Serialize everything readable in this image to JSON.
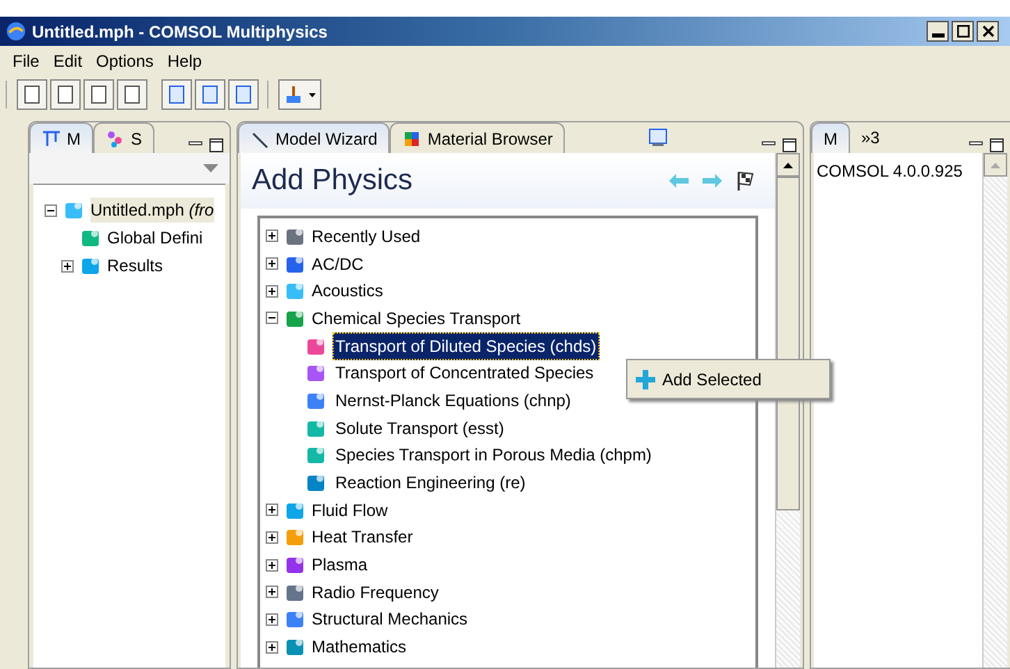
{
  "window": {
    "title": "Untitled.mph - COMSOL Multiphysics"
  },
  "menu": [
    "File",
    "Edit",
    "Options",
    "Help"
  ],
  "left_panel": {
    "tabs": [
      {
        "label": "M",
        "selected": true
      },
      {
        "label": "S",
        "selected": false
      }
    ],
    "tree": [
      {
        "label": "Untitled.mph *(fro*",
        "expanded": true,
        "selected": true,
        "children": [
          {
            "label": "Global Defini",
            "selected": false
          },
          {
            "label": "Results",
            "expanded": false,
            "selected": false
          }
        ]
      }
    ]
  },
  "center_panel": {
    "tabs": [
      {
        "label": "Model Wizard",
        "selected": true
      },
      {
        "label": "Material Browser",
        "selected": false
      }
    ],
    "heading": "Add Physics",
    "tree": [
      {
        "label": "Recently Used",
        "expanded": false
      },
      {
        "label": "AC/DC",
        "expanded": false
      },
      {
        "label": "Acoustics",
        "expanded": false
      },
      {
        "label": "Chemical Species Transport",
        "expanded": true,
        "children": [
          {
            "label": "Transport of Diluted Species (chds)",
            "selected": true
          },
          {
            "label": "Transport of Concentrated Species",
            "selected": false
          },
          {
            "label": "Nernst-Planck Equations (chnp)",
            "selected": false
          },
          {
            "label": "Solute Transport (esst)",
            "selected": false
          },
          {
            "label": "Species Transport in Porous Media (chpm)",
            "selected": false
          },
          {
            "label": "Reaction Engineering (re)",
            "selected": false
          }
        ]
      },
      {
        "label": "Fluid Flow",
        "expanded": false
      },
      {
        "label": "Heat Transfer",
        "expanded": false
      },
      {
        "label": "Plasma",
        "expanded": false
      },
      {
        "label": "Radio Frequency",
        "expanded": false
      },
      {
        "label": "Structural Mechanics",
        "expanded": false
      },
      {
        "label": "Mathematics",
        "expanded": false
      }
    ]
  },
  "context_menu": {
    "items": [
      "Add Selected"
    ]
  },
  "right_panel": {
    "tabs": [
      {
        "label": "M",
        "selected": true
      },
      {
        "label": "»3",
        "selected": false
      }
    ],
    "text": "COMSOL 4.0.0.925"
  }
}
